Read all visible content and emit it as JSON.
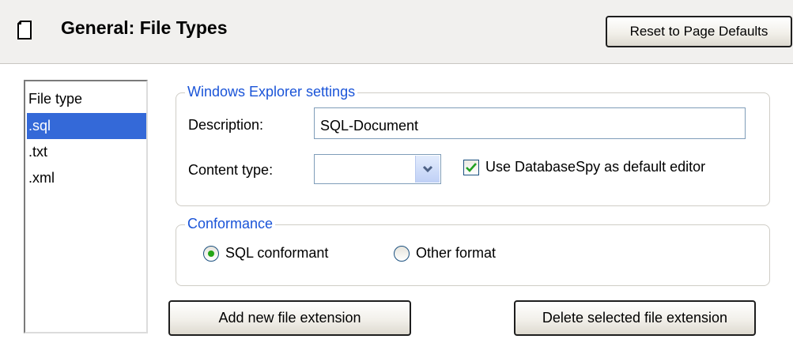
{
  "header": {
    "title": "General: File Types",
    "reset_button": "Reset to Page Defaults",
    "icon": "page-icon"
  },
  "file_list": {
    "header": "File type",
    "items": [
      ".sql",
      ".txt",
      ".xml"
    ],
    "selected": ".sql"
  },
  "explorer": {
    "group_label": "Windows Explorer settings",
    "description_label": "Description:",
    "description_value": "SQL-Document",
    "content_type_label": "Content type:",
    "content_type_value": "",
    "use_default_editor_label": "Use DatabaseSpy as default editor",
    "use_default_editor_checked": true
  },
  "conformance": {
    "group_label": "Conformance",
    "options": [
      "SQL conformant",
      "Other format"
    ],
    "selected": "SQL conformant"
  },
  "actions": {
    "add_label": "Add new file extension",
    "delete_label": "Delete selected file extension"
  },
  "colors": {
    "group_label": "#1a54d8",
    "selection": "#3469d8",
    "radio_dot": "#23a516"
  }
}
